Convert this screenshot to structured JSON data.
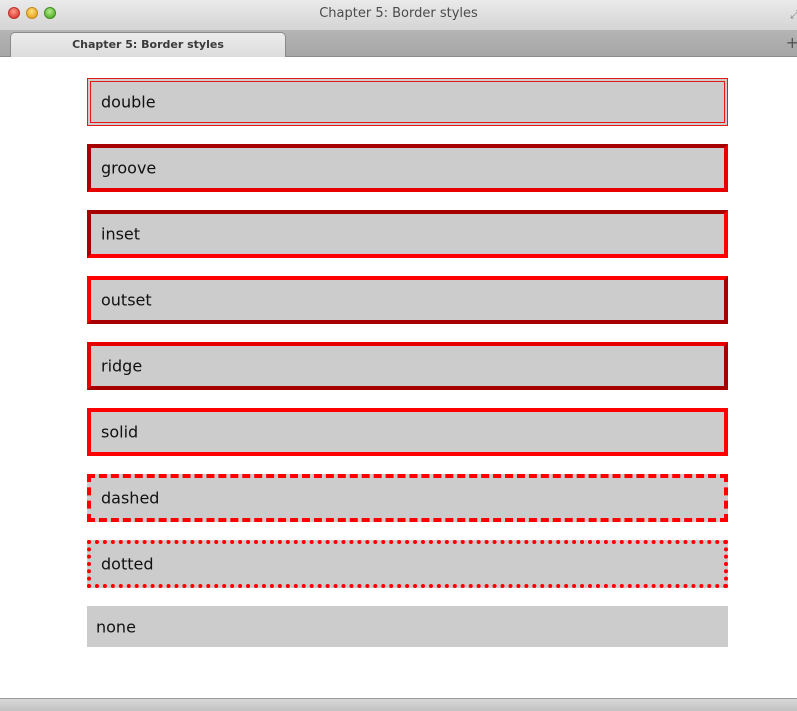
{
  "window": {
    "title": "Chapter 5: Border styles"
  },
  "tabs": [
    {
      "label": "Chapter 5: Border styles",
      "active": true
    }
  ],
  "icons": {
    "close": "close-icon",
    "minimize": "minimize-icon",
    "zoom": "zoom-icon",
    "fullscreen": "fullscreen-icon",
    "new_tab": "plus-icon"
  },
  "colors": {
    "border": "#ff0000",
    "box_background": "#cccccc",
    "page_background": "#ffffff"
  },
  "boxes": [
    {
      "style": "double",
      "label": "double"
    },
    {
      "style": "groove",
      "label": "groove"
    },
    {
      "style": "inset",
      "label": "inset"
    },
    {
      "style": "outset",
      "label": "outset"
    },
    {
      "style": "ridge",
      "label": "ridge"
    },
    {
      "style": "solid",
      "label": "solid"
    },
    {
      "style": "dashed",
      "label": "dashed"
    },
    {
      "style": "dotted",
      "label": "dotted"
    },
    {
      "style": "none",
      "label": "none"
    }
  ]
}
